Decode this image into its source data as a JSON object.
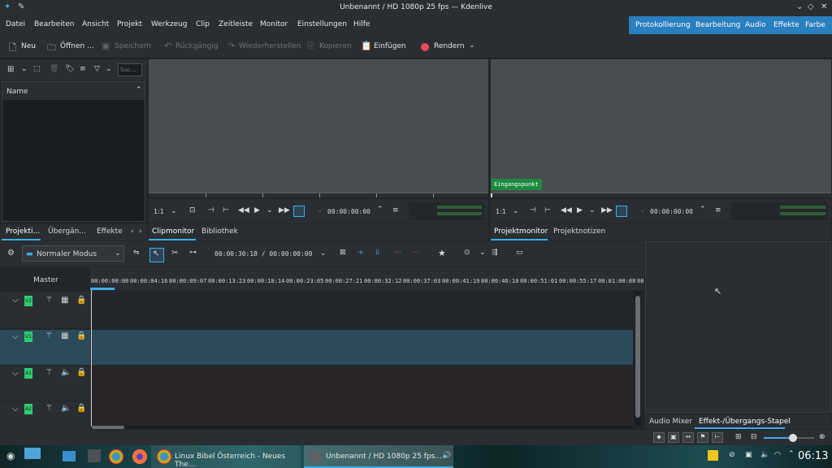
{
  "window": {
    "title": "Unbenannt / HD 1080p 25 fps — Kdenlive"
  },
  "menu": {
    "items": [
      "Datei",
      "Bearbeiten",
      "Ansicht",
      "Projekt",
      "Werkzeug",
      "Clip",
      "Zeitleiste",
      "Monitor",
      "Einstellungen",
      "Hilfe"
    ]
  },
  "workspaces": {
    "items": [
      "Protokollierung",
      "Bearbeitung",
      "Audio",
      "Effekte",
      "Farbe"
    ]
  },
  "toolbar": {
    "new": "Neu",
    "open": "Öffnen ...",
    "save": "Speichern",
    "undo": "Rückgängig",
    "redo": "Wiederherstellen",
    "copy": "Kopieren",
    "paste": "Einfügen",
    "render": "Rendern",
    "render_color": "#e74c5c"
  },
  "bin": {
    "search_placeholder": "Suc...",
    "column_name": "Name",
    "tabs": [
      "Projekti...",
      "Übergän...",
      "Effekte"
    ]
  },
  "clip_monitor": {
    "zoom": "1:1",
    "timecode": "00:00:00:00",
    "tabs": [
      "Clipmonitor",
      "Bibliothek"
    ]
  },
  "project_monitor": {
    "zoom": "1:1",
    "timecode": "00:00:00:00",
    "marker": "Eingangspunkt",
    "tabs": [
      "Projektmonitor",
      "Projektnotizen"
    ]
  },
  "timeline_toolbar": {
    "mode": "Normaler Modus",
    "timecode": "00:00:30:18 / 00:00:00:00"
  },
  "timeline": {
    "master_label": "Master",
    "ruler": [
      "00:00:00:00",
      "00:00:04:16",
      "00:00:09:07",
      "00:00:13:23",
      "00:00:18:14",
      "00:00:23:05",
      "00:00:27:21",
      "00:00:32:12",
      "00:00:37:03",
      "00:00:41:19",
      "00:00:46:10",
      "00:00:51:01",
      "00:00:55:17",
      "00:01:00:08",
      "00:0"
    ],
    "tracks": [
      {
        "name": "V2",
        "type": "video"
      },
      {
        "name": "V1",
        "type": "video"
      },
      {
        "name": "A1",
        "type": "audio"
      },
      {
        "name": "A2",
        "type": "audio"
      }
    ]
  },
  "effect_stack": {
    "tabs": [
      "Audio Mixer",
      "Effekt-/Übergangs-Stapel"
    ]
  },
  "taskbar": {
    "tasks": [
      "Linux Bibel Österreich - Neues The...",
      "Unbenannt / HD 1080p 25 fps..."
    ],
    "clock": "06:13"
  },
  "colors": {
    "accent": "#3daee9",
    "workspace_bar": "#2a7fbf",
    "track_label": "#2ecc71",
    "selected_track": "#2c4b5a",
    "audio_track": "#2a2528"
  }
}
